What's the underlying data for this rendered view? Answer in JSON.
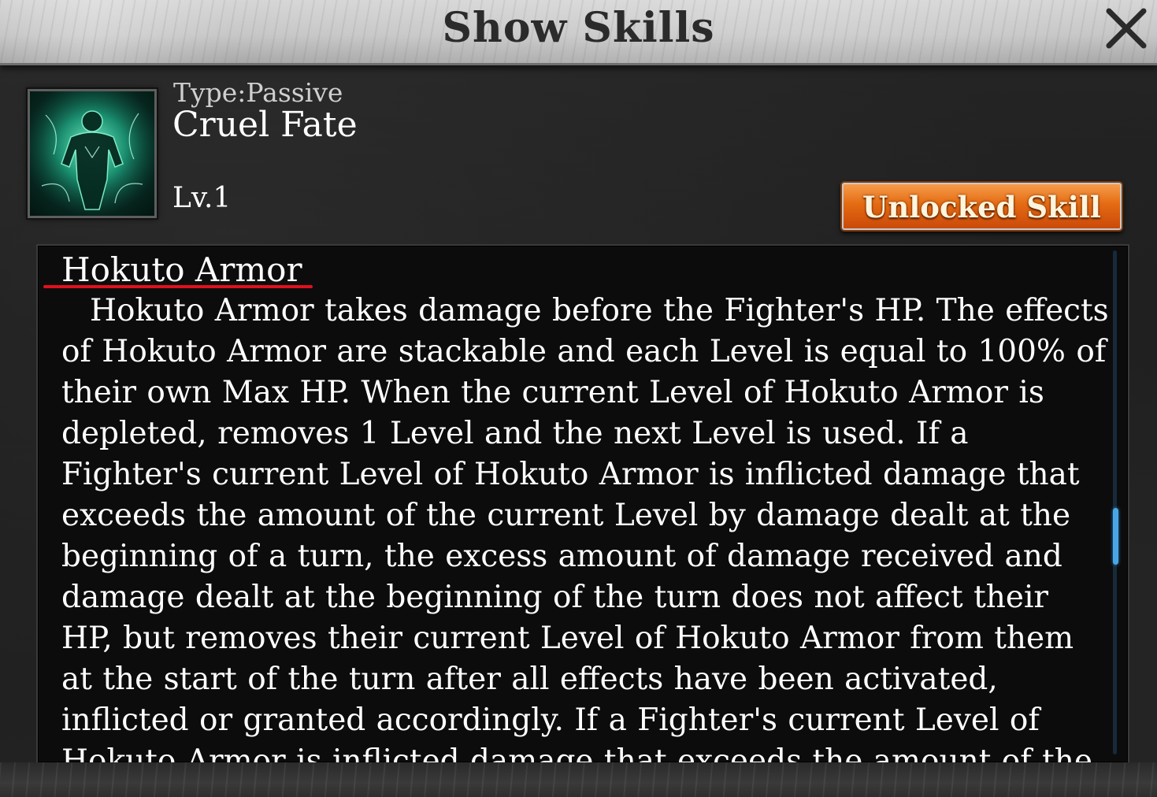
{
  "window": {
    "title": "Show Skills",
    "close_icon": "close-icon"
  },
  "skill": {
    "icon": "skill-portrait-icon",
    "type_label": "Type:Passive",
    "name": "Cruel Fate",
    "level": "Lv.1",
    "status_button": "Unlocked Skill"
  },
  "description": {
    "effect_title": "Hokuto Armor",
    "effect_body": "Hokuto Armor takes damage before the Fighter's HP. The effects of Hokuto Armor are stackable and each Level is equal to 100% of their own Max HP. When the current Level of Hokuto Armor is depleted, removes 1 Level and the next Level is used. If a Fighter's current Level of Hokuto Armor is inflicted damage that exceeds the amount of the current Level by damage dealt at the beginning of a turn, the excess amount of damage received and damage dealt at the beginning of the turn does not affect their HP, but removes their current Level of Hokuto Armor from them at the start of the turn after all effects have been activated, inflicted or granted accordingly. If a Fighter's current Level of Hokuto Armor is inflicted damage that exceeds the amount of the"
  },
  "colors": {
    "title_bar": "#c7c7c7",
    "button_orange": "#e46b12",
    "underline_red": "#e0101d",
    "scroll_blue": "#49a6e6",
    "icon_glow": "#1fae86"
  }
}
